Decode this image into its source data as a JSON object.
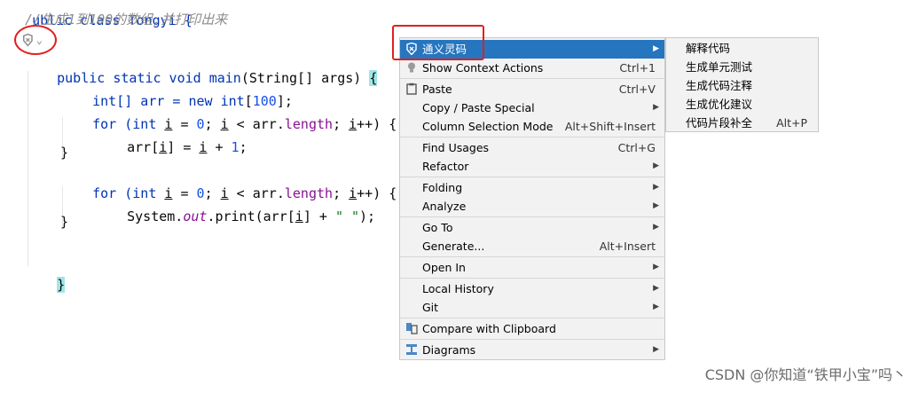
{
  "editor": {
    "class_line_fragment": "ublic class Tongyi {",
    "comment": "//生成1到100的数组,并打印出来",
    "line_main": [
      "public static void main",
      "(String[] args) ",
      "{"
    ],
    "line_array": [
      "int[] arr = ",
      "new int",
      "[",
      "100",
      "];"
    ],
    "for1": [
      "for (",
      "int ",
      "i",
      " = ",
      "0",
      "; ",
      "i",
      " < arr.",
      "length",
      "; ",
      "i",
      "++) {"
    ],
    "assign": [
      "arr[",
      "i",
      "] = ",
      "i",
      " + ",
      "1",
      ";"
    ],
    "close_inner": "}",
    "for2": [
      "for (",
      "int ",
      "i",
      " = ",
      "0",
      "; ",
      "i",
      " < arr.",
      "length",
      "; ",
      "i",
      "++) {"
    ],
    "print": [
      "System.",
      "out",
      ".print(arr[",
      "i",
      "] + ",
      "\" \"",
      ");"
    ],
    "close_inner2": "}",
    "close_main": "}"
  },
  "context_menu": {
    "items": [
      {
        "label": "通义灵码",
        "shortcut": "",
        "submenu": true,
        "selected": true,
        "icon": "tongyi-icon"
      },
      {
        "label": "Show Context Actions",
        "shortcut": "Ctrl+1",
        "submenu": false,
        "icon": "bulb-icon"
      },
      {
        "label": "Paste",
        "shortcut": "Ctrl+V",
        "submenu": false,
        "icon": "clipboard-icon"
      },
      {
        "label": "Copy / Paste Special",
        "shortcut": "",
        "submenu": true
      },
      {
        "label": "Column Selection Mode",
        "shortcut": "Alt+Shift+Insert",
        "submenu": false
      },
      {
        "label": "Find Usages",
        "shortcut": "Ctrl+G",
        "submenu": false
      },
      {
        "label": "Refactor",
        "shortcut": "",
        "submenu": true
      },
      {
        "label": "Folding",
        "shortcut": "",
        "submenu": true
      },
      {
        "label": "Analyze",
        "shortcut": "",
        "submenu": true
      },
      {
        "label": "Go To",
        "shortcut": "",
        "submenu": true
      },
      {
        "label": "Generate...",
        "shortcut": "Alt+Insert",
        "submenu": false
      },
      {
        "label": "Open In",
        "shortcut": "",
        "submenu": true
      },
      {
        "label": "Local History",
        "shortcut": "",
        "submenu": true
      },
      {
        "label": "Git",
        "shortcut": "",
        "submenu": true
      },
      {
        "label": "Compare with Clipboard",
        "shortcut": "",
        "submenu": false,
        "icon": "compare-icon"
      },
      {
        "label": "Diagrams",
        "shortcut": "",
        "submenu": true,
        "icon": "diagram-icon"
      }
    ]
  },
  "submenu": {
    "items": [
      {
        "label": "解释代码",
        "shortcut": ""
      },
      {
        "label": "生成单元测试",
        "shortcut": ""
      },
      {
        "label": "生成代码注释",
        "shortcut": ""
      },
      {
        "label": "生成优化建议",
        "shortcut": ""
      },
      {
        "label": "代码片段补全",
        "shortcut": "Alt+P"
      }
    ]
  },
  "watermark": "CSDN @你知道“铁甲小宝”吗丶",
  "colors": {
    "selection": "#2675bf",
    "annotation_red": "#e02020"
  }
}
